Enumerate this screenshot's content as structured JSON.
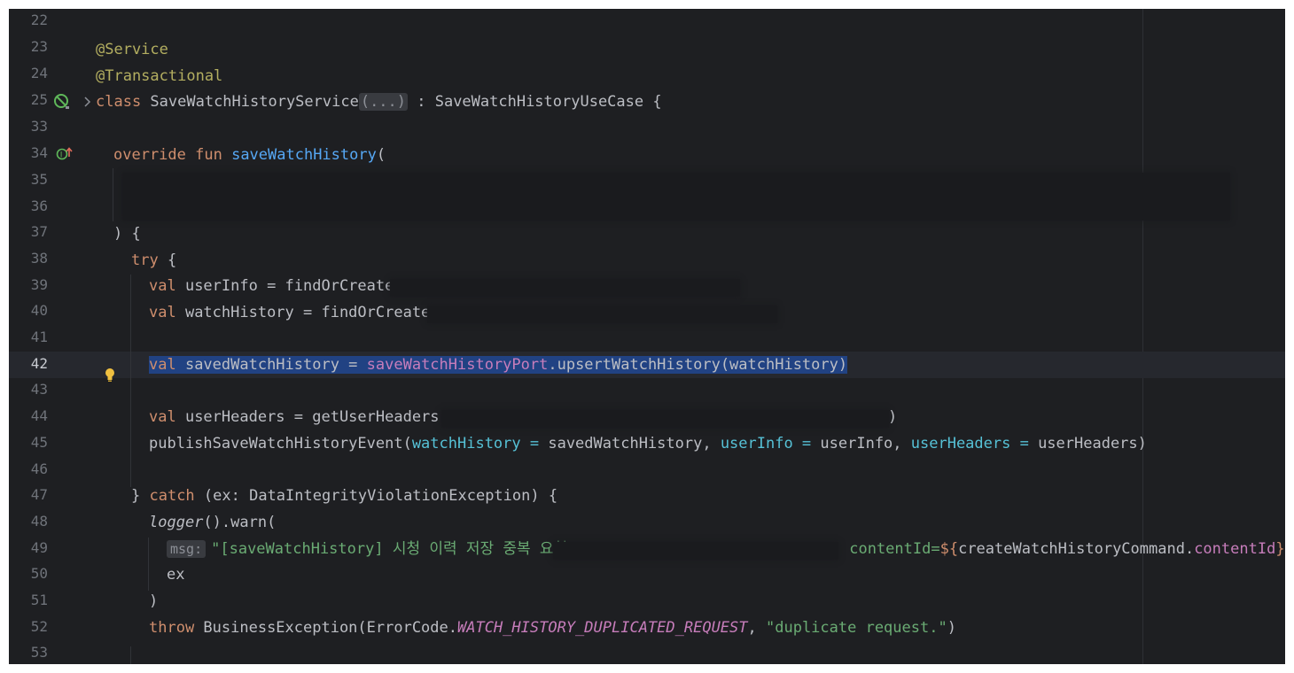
{
  "gutter": {
    "line_numbers": [
      "22",
      "23",
      "24",
      "25",
      "33",
      "34",
      "35",
      "36",
      "37",
      "38",
      "39",
      "40",
      "41",
      "42",
      "43",
      "44",
      "45",
      "46",
      "47",
      "48",
      "49",
      "50",
      "51",
      "52",
      "53"
    ]
  },
  "code": {
    "l23": "@Service",
    "l24": "@Transactional",
    "l25_kw": "class",
    "l25_name": " SaveWatchHistoryService",
    "l25_fold": "(...)",
    "l25_rest": " : SaveWatchHistoryUseCase {",
    "l34_kw": "override fun",
    "l34_fn": "saveWatchHistory",
    "l34_paren": "(",
    "l37": ") {",
    "l38_kw": "try",
    "l38_rest": " {",
    "l39_kw": "val",
    "l39_rest": " userInfo = findOrCreate(",
    "l40_kw": "val",
    "l40_rest": " watchHistory = findOrCreate(",
    "l42_kw": "val",
    "l42_var": " savedWatchHistory = ",
    "l42_prop": "saveWatchHistoryPort",
    "l42_rest": ".upsertWatchHistory(watchHistory)",
    "l44_kw": "val",
    "l44_rest": " userHeaders = getUserHeaders(",
    "l44_end": ")",
    "l45_fn": "publishSaveWatchHistoryEvent(",
    "l45_n1": "watchHistory =",
    "l45_v1": " savedWatchHistory, ",
    "l45_n2": "userInfo =",
    "l45_v2": " userInfo, ",
    "l45_n3": "userHeaders =",
    "l45_v3": " userHeaders)",
    "l47_brace": "} ",
    "l47_kw": "catch",
    "l47_rest": " (ex: DataIntegrityViolationException) {",
    "l48_italic": "logger",
    "l48_rest": "().warn(",
    "l49_hint": "msg:",
    "l49_str": "\"[saveWatchHistory] 시청 이력 저장 중복 요청",
    "l49_str2": " contentId=",
    "l49_tmpl": "${",
    "l49_expr": "createWatchHistoryCommand.",
    "l49_prop": "contentId",
    "l49_close": "}",
    "l49_tail": ",",
    "l50": "ex",
    "l51": ")",
    "l52_kw": "throw",
    "l52_rest": " BusinessException(ErrorCode.",
    "l52_const": "WATCH_HISTORY_DUPLICATED_REQUEST",
    "l52_comma": ", ",
    "l52_str": "\"duplicate request.\"",
    "l52_end": ")"
  },
  "icons": {
    "l25_gutter": "spring-bean-icon",
    "l25_fold": "chevron-right-icon",
    "l34_gutter": "implements-method-icon",
    "l43_gutter": "lightbulb-icon"
  }
}
